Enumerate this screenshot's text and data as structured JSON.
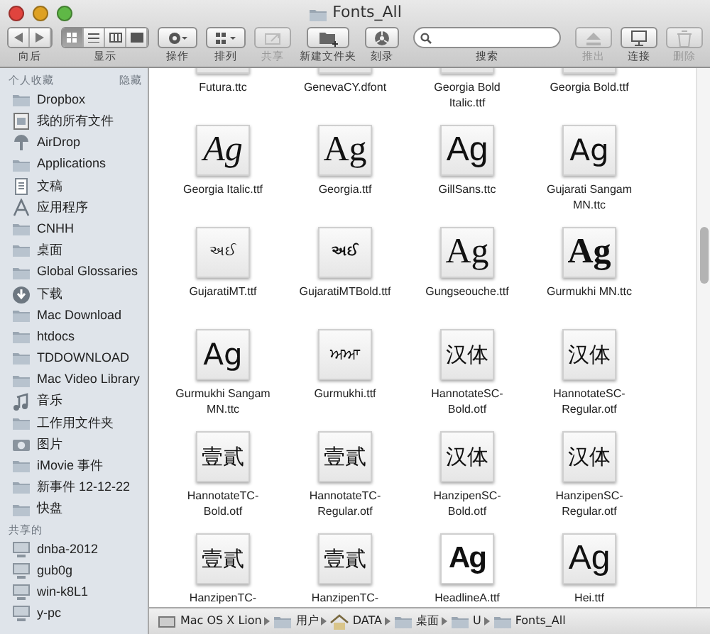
{
  "window": {
    "title": "Fonts_All"
  },
  "toolbar": [
    {
      "kind": "nav",
      "label": "向后",
      "disabled": false
    },
    {
      "kind": "view",
      "label": "显示",
      "disabled": false,
      "segments": [
        {
          "selected": true
        },
        {
          "selected": false
        },
        {
          "selected": false
        },
        {
          "selected": false
        }
      ]
    },
    {
      "kind": "action",
      "label": "操作",
      "disabled": false
    },
    {
      "kind": "arrange",
      "label": "排列",
      "disabled": false
    },
    {
      "kind": "share",
      "label": "共享",
      "disabled": true
    },
    {
      "kind": "newfolder",
      "label": "新建文件夹",
      "disabled": false
    },
    {
      "kind": "burn",
      "label": "刻录",
      "disabled": false
    },
    {
      "kind": "search",
      "label": "搜索",
      "disabled": false
    },
    {
      "kind": "eject",
      "label": "推出",
      "disabled": true
    },
    {
      "kind": "connect",
      "label": "连接",
      "disabled": false
    },
    {
      "kind": "delete",
      "label": "删除",
      "disabled": true
    }
  ],
  "sidebar": {
    "sections": [
      {
        "title": "个人收藏",
        "action": "隐藏",
        "items": [
          {
            "label": "Dropbox",
            "kind": "folder"
          },
          {
            "label": "我的所有文件",
            "kind": "allfiles"
          },
          {
            "label": "AirDrop",
            "kind": "airdrop"
          },
          {
            "label": "Applications",
            "kind": "folder"
          },
          {
            "label": "文稿",
            "kind": "docs"
          },
          {
            "label": "应用程序",
            "kind": "apps"
          },
          {
            "label": "CNHH",
            "kind": "folder"
          },
          {
            "label": "桌面",
            "kind": "folder"
          },
          {
            "label": "Global Glossaries",
            "kind": "folder"
          },
          {
            "label": "下载",
            "kind": "download"
          },
          {
            "label": "Mac Download",
            "kind": "folder"
          },
          {
            "label": "htdocs",
            "kind": "folder"
          },
          {
            "label": "TDDOWNLOAD",
            "kind": "folder"
          },
          {
            "label": "Mac Video Library",
            "kind": "folder"
          },
          {
            "label": "音乐",
            "kind": "music"
          },
          {
            "label": "工作用文件夹",
            "kind": "folder"
          },
          {
            "label": "图片",
            "kind": "camera"
          },
          {
            "label": "iMovie 事件",
            "kind": "folder"
          },
          {
            "label": "新事件 12-12-22",
            "kind": "folder"
          },
          {
            "label": "快盘",
            "kind": "folder"
          }
        ]
      },
      {
        "title": "共享的",
        "items": [
          {
            "label": "dnba-2012",
            "kind": "computer"
          },
          {
            "label": "gub0g",
            "kind": "computer"
          },
          {
            "label": "win-k8L1",
            "kind": "computer"
          },
          {
            "label": "y-pc",
            "kind": "computer"
          }
        ]
      }
    ]
  },
  "files": [
    {
      "name": "Futura.ttc"
    },
    {
      "name": "GenevaCY.dfont"
    },
    {
      "name": "Georgia Bold Italic.ttf"
    },
    {
      "name": "Georgia Bold.ttf"
    },
    {
      "name": "Georgia Italic.ttf",
      "sample": "Ag",
      "kind": "serif-italic"
    },
    {
      "name": "Georgia.ttf",
      "sample": "Ag",
      "kind": "serif"
    },
    {
      "name": "GillSans.ttc",
      "sample": "Ag",
      "kind": "sans"
    },
    {
      "name": "Gujarati Sangam MN.ttc",
      "sample": "Ag",
      "kind": "sans-light"
    },
    {
      "name": "GujaratiMT.ttf",
      "sample": "અઈ",
      "kind": "gujarati"
    },
    {
      "name": "GujaratiMTBold.ttf",
      "sample": "અઈ",
      "kind": "gujarati-bold"
    },
    {
      "name": "Gungseouche.ttf",
      "sample": "Ag",
      "kind": "serif"
    },
    {
      "name": "Gurmukhi MN.ttc",
      "sample": "Ag",
      "kind": "serif-bold"
    },
    {
      "name": "Gurmukhi Sangam MN.ttc",
      "sample": "Ag",
      "kind": "sans-light"
    },
    {
      "name": "Gurmukhi.ttf",
      "sample": "ਅਆ",
      "kind": "small"
    },
    {
      "name": "HannotateSC-Bold.otf",
      "sample": "汉体",
      "kind": "cjk"
    },
    {
      "name": "HannotateSC-Regular.otf",
      "sample": "汉体",
      "kind": "cjk"
    },
    {
      "name": "HannotateTC-Bold.otf",
      "sample": "壹貳",
      "kind": "cjk"
    },
    {
      "name": "HannotateTC-Regular.otf",
      "sample": "壹貳",
      "kind": "cjk"
    },
    {
      "name": "HanzipenSC-Bold.otf",
      "sample": "汉体",
      "kind": "cjk"
    },
    {
      "name": "HanzipenSC-Regular.otf",
      "sample": "汉体",
      "kind": "cjk"
    },
    {
      "name": "HanzipenTC-",
      "sample": "壹貳",
      "kind": "cjk"
    },
    {
      "name": "HanzipenTC-",
      "sample": "壹貳",
      "kind": "cjk"
    },
    {
      "name": "HeadlineA.ttf",
      "sample": "Ag",
      "kind": "heavy"
    },
    {
      "name": "Hei.ttf",
      "sample": "Ag",
      "kind": "sans"
    }
  ],
  "path_bar": [
    {
      "label": "Mac OS X Lion",
      "kind": "disk"
    },
    {
      "label": "用户",
      "kind": "folder"
    },
    {
      "label": "DATA",
      "kind": "home"
    },
    {
      "label": "桌面",
      "kind": "folder"
    },
    {
      "label": "U",
      "kind": "folder"
    },
    {
      "label": "Fonts_All",
      "kind": "folder"
    }
  ]
}
